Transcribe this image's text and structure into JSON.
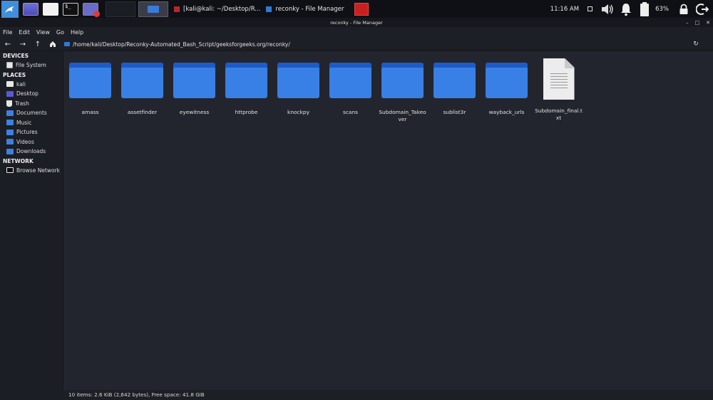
{
  "panel": {
    "tasks": [
      {
        "label": "[kali@kali: ~/Desktop/R..."
      },
      {
        "label": "reconky - File Manager"
      }
    ],
    "clock": "11:16 AM",
    "battery": "63%"
  },
  "window": {
    "title": "reconky - File Manager",
    "controls": [
      "–",
      "□",
      "✕"
    ]
  },
  "menu": [
    "File",
    "Edit",
    "View",
    "Go",
    "Help"
  ],
  "location": {
    "path": "/home/kali/Desktop/Reconky-Automated_Bash_Script/geeksforgeeks.org/reconky/"
  },
  "sidebar": {
    "devices_header": "DEVICES",
    "devices": [
      {
        "label": "File System",
        "icon": "drive-icon"
      }
    ],
    "places_header": "PLACES",
    "places": [
      {
        "label": "kali",
        "icon": "home-folder-icon"
      },
      {
        "label": "Desktop",
        "icon": "desktop-icon"
      },
      {
        "label": "Trash",
        "icon": "trash-icon"
      },
      {
        "label": "Documents",
        "icon": "documents-folder-icon"
      },
      {
        "label": "Music",
        "icon": "music-folder-icon"
      },
      {
        "label": "Pictures",
        "icon": "pictures-folder-icon"
      },
      {
        "label": "Videos",
        "icon": "videos-folder-icon"
      },
      {
        "label": "Downloads",
        "icon": "downloads-folder-icon"
      }
    ],
    "network_header": "NETWORK",
    "network": [
      {
        "label": "Browse Network",
        "icon": "network-icon"
      }
    ]
  },
  "items": [
    {
      "name": "amass",
      "type": "folder"
    },
    {
      "name": "assetfinder",
      "type": "folder"
    },
    {
      "name": "eyewitness",
      "type": "folder"
    },
    {
      "name": "httprobe",
      "type": "folder"
    },
    {
      "name": "knockpy",
      "type": "folder"
    },
    {
      "name": "scans",
      "type": "folder"
    },
    {
      "name": "Subdomain_Takeover",
      "type": "folder"
    },
    {
      "name": "sublist3r",
      "type": "folder"
    },
    {
      "name": "wayback_urls",
      "type": "folder"
    },
    {
      "name": "Subdomain_final.txt",
      "type": "file"
    }
  ],
  "status": "10 items: 2.6 KiB (2,642 bytes), Free space: 41.8 GiB"
}
